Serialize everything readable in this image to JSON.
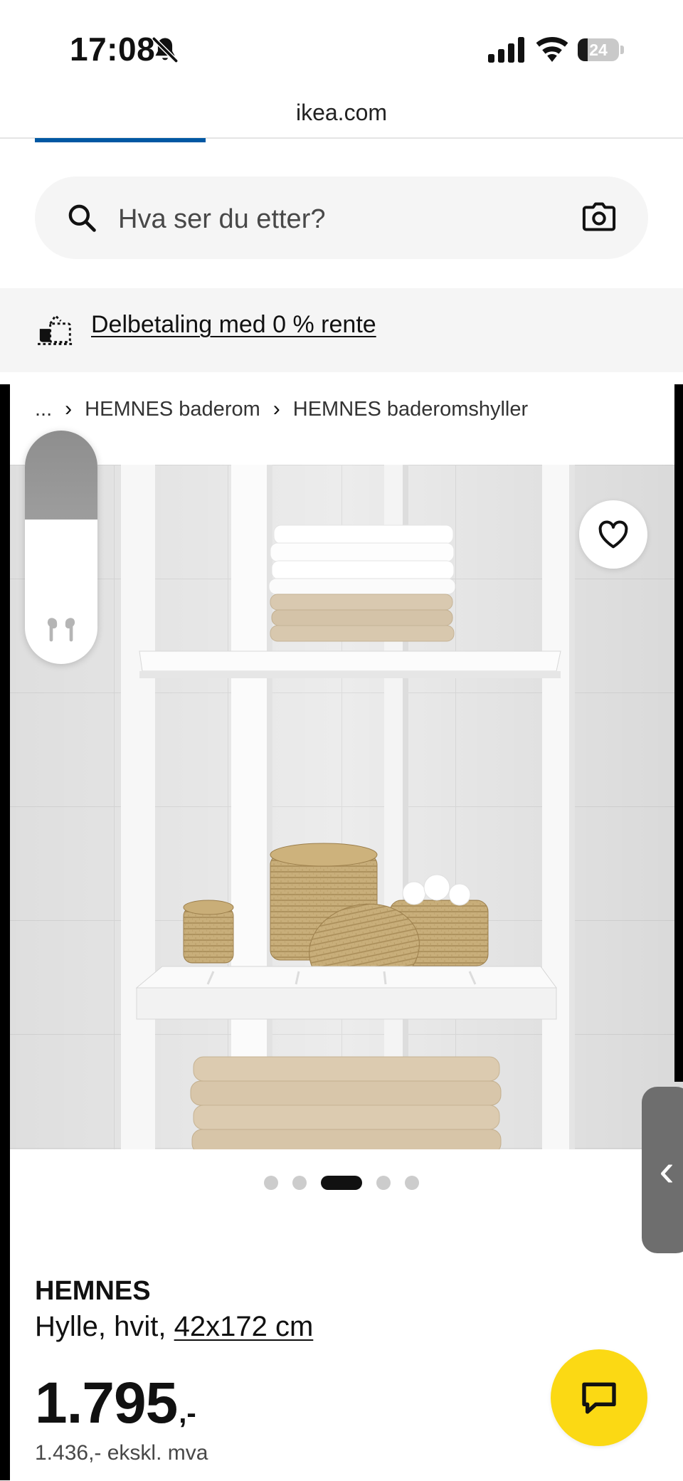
{
  "status_bar": {
    "time": "17:08",
    "battery_level": "24",
    "icons": [
      "bell-slash-icon",
      "signal-icon",
      "wifi-icon",
      "battery-icon"
    ]
  },
  "browser": {
    "url": "ikea.com"
  },
  "search": {
    "placeholder": "Hva ser du etter?",
    "icons": [
      "search-icon",
      "camera-icon"
    ]
  },
  "promo": {
    "link_text": "Delbetaling med 0 % rente",
    "icon": "payment-icon"
  },
  "breadcrumb": {
    "items": [
      "...",
      "HEMNES baderom",
      "HEMNES baderomshyller"
    ],
    "separator": "›"
  },
  "gallery": {
    "image_count": 5,
    "active_index": 2,
    "favorite_icon": "heart-icon"
  },
  "product": {
    "name": "HEMNES",
    "description_prefix": "Hylle, hvit, ",
    "size_link": "42x172 cm",
    "price_main": "1.795",
    "price_suffix": ",-",
    "price_ex_vat": "1.436,- ekskl. mva"
  },
  "overlays": {
    "volume_level": 0.38,
    "volume_icon": "airpods-icon",
    "side_handle_glyph": "‹"
  },
  "chat": {
    "icon": "chat-icon"
  },
  "colors": {
    "ikea_blue": "#0058a3",
    "ikea_yellow": "#fbd914",
    "search_bg": "#f5f5f5"
  }
}
